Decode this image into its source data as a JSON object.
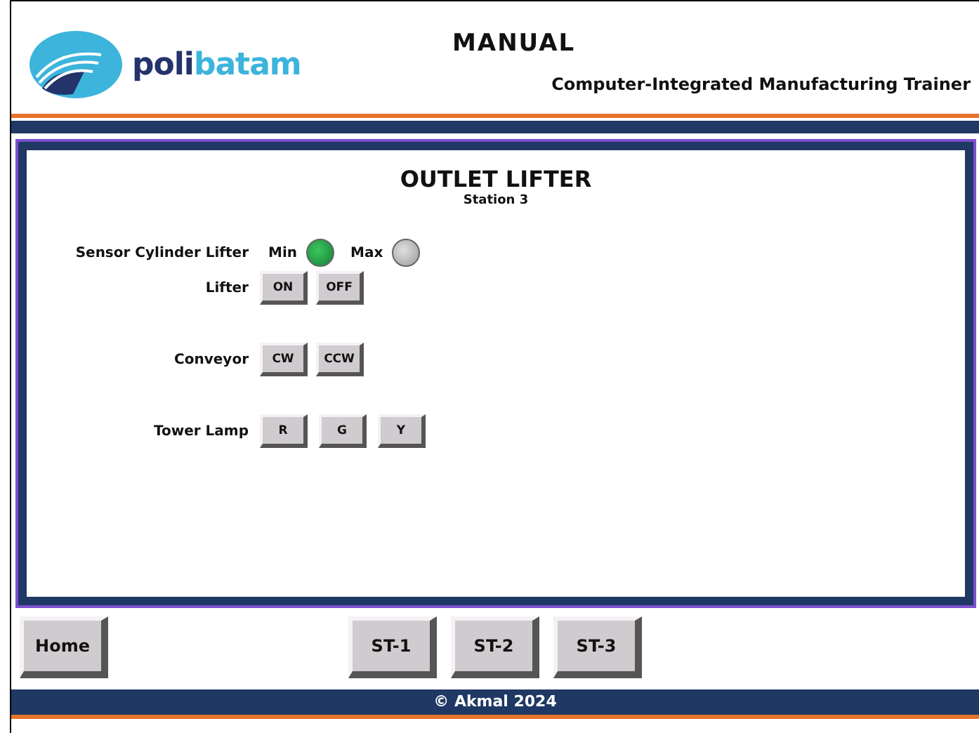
{
  "header": {
    "logo": {
      "part1": "poli",
      "part2": "batam"
    },
    "title": "MANUAL",
    "subtitle": "Computer-Integrated Manufacturing Trainer"
  },
  "panel": {
    "title": "OUTLET LIFTER",
    "subtitle": "Station 3",
    "rows": [
      {
        "kind": "lamps",
        "label": "Sensor Cylinder Lifter",
        "lamps": [
          {
            "label": "Min",
            "on": true
          },
          {
            "label": "Max",
            "on": false
          }
        ]
      },
      {
        "kind": "buttons",
        "label": "Lifter",
        "buttons": [
          "ON",
          "OFF"
        ]
      },
      {
        "kind": "buttons",
        "label": "Conveyor",
        "buttons": [
          "CW",
          "CCW"
        ]
      },
      {
        "kind": "buttons",
        "label": "Tower Lamp",
        "buttons": [
          "R",
          "G",
          "Y"
        ]
      }
    ]
  },
  "nav": {
    "home": "Home",
    "stations": [
      "ST-1",
      "ST-2",
      "ST-3"
    ]
  },
  "footer": "© Akmal 2024"
}
